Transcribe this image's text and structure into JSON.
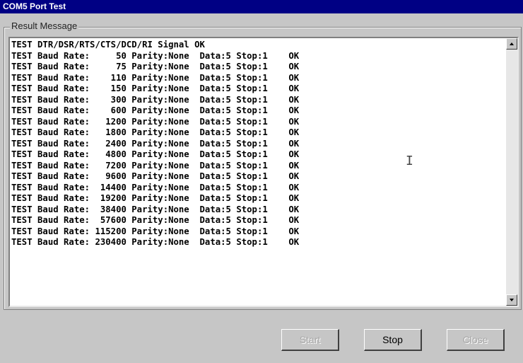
{
  "window": {
    "title": "COM5 Port Test"
  },
  "group": {
    "label": "Result Message"
  },
  "output": {
    "lines": [
      "TEST DTR/DSR/RTS/CTS/DCD/RI Signal OK",
      "TEST Baud Rate:     50 Parity:None  Data:5 Stop:1    OK",
      "TEST Baud Rate:     75 Parity:None  Data:5 Stop:1    OK",
      "TEST Baud Rate:    110 Parity:None  Data:5 Stop:1    OK",
      "TEST Baud Rate:    150 Parity:None  Data:5 Stop:1    OK",
      "TEST Baud Rate:    300 Parity:None  Data:5 Stop:1    OK",
      "TEST Baud Rate:    600 Parity:None  Data:5 Stop:1    OK",
      "TEST Baud Rate:   1200 Parity:None  Data:5 Stop:1    OK",
      "TEST Baud Rate:   1800 Parity:None  Data:5 Stop:1    OK",
      "TEST Baud Rate:   2400 Parity:None  Data:5 Stop:1    OK",
      "TEST Baud Rate:   4800 Parity:None  Data:5 Stop:1    OK",
      "TEST Baud Rate:   7200 Parity:None  Data:5 Stop:1    OK",
      "TEST Baud Rate:   9600 Parity:None  Data:5 Stop:1    OK",
      "TEST Baud Rate:  14400 Parity:None  Data:5 Stop:1    OK",
      "TEST Baud Rate:  19200 Parity:None  Data:5 Stop:1    OK",
      "TEST Baud Rate:  38400 Parity:None  Data:5 Stop:1    OK",
      "TEST Baud Rate:  57600 Parity:None  Data:5 Stop:1    OK",
      "TEST Baud Rate: 115200 Parity:None  Data:5 Stop:1    OK",
      "TEST Baud Rate: 230400 Parity:None  Data:5 Stop:1    OK"
    ]
  },
  "buttons": {
    "start": {
      "label": "Start",
      "enabled": false
    },
    "stop": {
      "label": "Stop",
      "enabled": true
    },
    "close": {
      "label": "Close",
      "enabled": false
    }
  },
  "colors": {
    "titlebar": "#000084",
    "face": "#c6c6c6",
    "text_bg": "#ffffff"
  },
  "icons": [
    "scroll-up-arrow-icon",
    "scroll-down-arrow-icon",
    "text-cursor-icon"
  ]
}
